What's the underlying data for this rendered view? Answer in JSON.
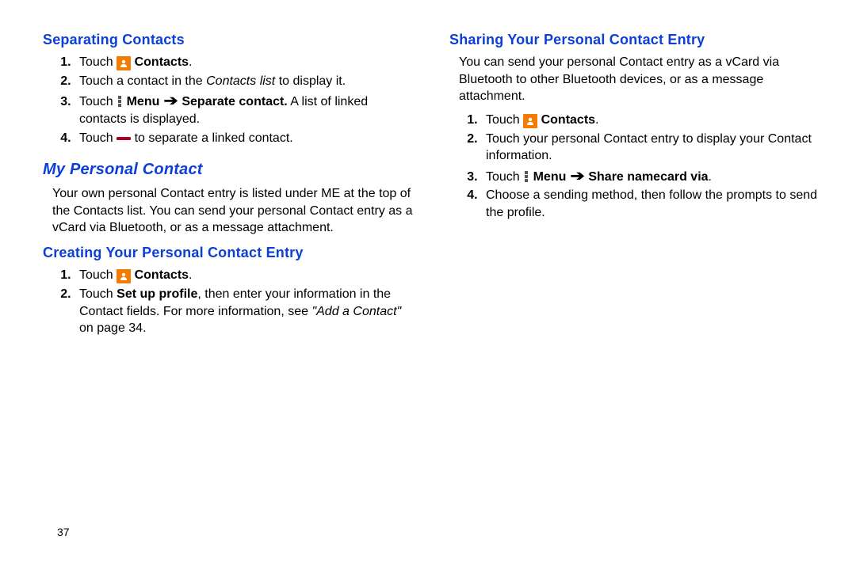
{
  "page_number": "37",
  "left": {
    "h1": "Separating Contacts",
    "steps1": {
      "s1_pre": "Touch ",
      "s1_post": " ",
      "s1_bold": "Contacts",
      "s1_end": ".",
      "s2_a": "Touch a contact in the ",
      "s2_i": "Contacts list",
      "s2_b": " to display it.",
      "s3_a": "Touch ",
      "s3_bold": " Menu ",
      "s3_bold2": " Separate contact.",
      "s3_b": " A list of linked contacts is displayed.",
      "s4_a": "Touch ",
      "s4_b": " to separate a linked contact."
    },
    "h2": "My Personal Contact",
    "para1": "Your own personal Contact entry is listed under ME at the top of the Contacts list. You can send your personal Contact entry as a vCard via Bluetooth, or as a message attachment.",
    "h3": "Creating Your Personal Contact Entry",
    "steps2": {
      "s1_pre": "Touch ",
      "s1_bold": "Contacts",
      "s1_end": ".",
      "s2_a": "Touch ",
      "s2_bold": "Set up profile",
      "s2_b": ", then enter your information in the Contact fields. For more information, see ",
      "s2_i": "\"Add a Contact\"",
      "s2_c": " on page 34."
    }
  },
  "right": {
    "h1": "Sharing Your Personal Contact Entry",
    "para1": "You can send your personal Contact entry as a vCard via Bluetooth to other Bluetooth devices, or as a message attachment.",
    "steps": {
      "s1_pre": "Touch ",
      "s1_bold": "Contacts",
      "s1_end": ".",
      "s2": "Touch your personal Contact entry to display your Contact information.",
      "s3_a": "Touch ",
      "s3_bold1": " Menu ",
      "s3_bold2": " Share namecard via",
      "s3_end": ".",
      "s4": "Choose a sending method, then follow the prompts to send the profile."
    }
  }
}
